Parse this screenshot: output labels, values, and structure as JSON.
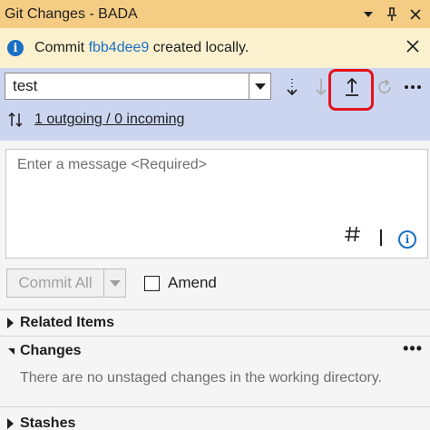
{
  "window": {
    "title": "Git Changes - BADA"
  },
  "info_bar": {
    "prefix": "Commit ",
    "commit_link": "fbb4dee9",
    "suffix": " created locally."
  },
  "branch": {
    "selected": "test"
  },
  "sync": {
    "label": "1 outgoing / 0 incoming"
  },
  "commit_message": {
    "placeholder": "Enter a message <Required>"
  },
  "commit": {
    "button_label": "Commit All",
    "amend_label": "Amend"
  },
  "sections": {
    "related_items": "Related Items",
    "changes": "Changes",
    "changes_empty": "There are no unstaged changes in the working directory.",
    "stashes": "Stashes"
  },
  "colors": {
    "titlebar": "#f5cc84",
    "infobar": "#fbf1cf",
    "branchbar": "#ccd5f0",
    "link": "#1a6fc4",
    "highlight": "#e3131b"
  }
}
